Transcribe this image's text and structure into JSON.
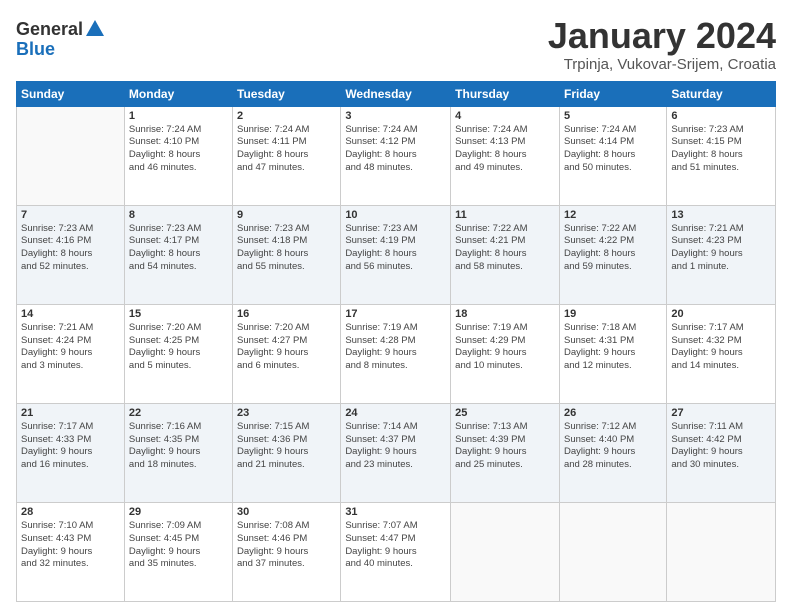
{
  "logo": {
    "general": "General",
    "blue": "Blue"
  },
  "title": {
    "month": "January 2024",
    "location": "Trpinja, Vukovar-Srijem, Croatia"
  },
  "headers": [
    "Sunday",
    "Monday",
    "Tuesday",
    "Wednesday",
    "Thursday",
    "Friday",
    "Saturday"
  ],
  "weeks": [
    [
      {
        "day": "",
        "info": ""
      },
      {
        "day": "1",
        "info": "Sunrise: 7:24 AM\nSunset: 4:10 PM\nDaylight: 8 hours\nand 46 minutes."
      },
      {
        "day": "2",
        "info": "Sunrise: 7:24 AM\nSunset: 4:11 PM\nDaylight: 8 hours\nand 47 minutes."
      },
      {
        "day": "3",
        "info": "Sunrise: 7:24 AM\nSunset: 4:12 PM\nDaylight: 8 hours\nand 48 minutes."
      },
      {
        "day": "4",
        "info": "Sunrise: 7:24 AM\nSunset: 4:13 PM\nDaylight: 8 hours\nand 49 minutes."
      },
      {
        "day": "5",
        "info": "Sunrise: 7:24 AM\nSunset: 4:14 PM\nDaylight: 8 hours\nand 50 minutes."
      },
      {
        "day": "6",
        "info": "Sunrise: 7:23 AM\nSunset: 4:15 PM\nDaylight: 8 hours\nand 51 minutes."
      }
    ],
    [
      {
        "day": "7",
        "info": "Sunrise: 7:23 AM\nSunset: 4:16 PM\nDaylight: 8 hours\nand 52 minutes."
      },
      {
        "day": "8",
        "info": "Sunrise: 7:23 AM\nSunset: 4:17 PM\nDaylight: 8 hours\nand 54 minutes."
      },
      {
        "day": "9",
        "info": "Sunrise: 7:23 AM\nSunset: 4:18 PM\nDaylight: 8 hours\nand 55 minutes."
      },
      {
        "day": "10",
        "info": "Sunrise: 7:23 AM\nSunset: 4:19 PM\nDaylight: 8 hours\nand 56 minutes."
      },
      {
        "day": "11",
        "info": "Sunrise: 7:22 AM\nSunset: 4:21 PM\nDaylight: 8 hours\nand 58 minutes."
      },
      {
        "day": "12",
        "info": "Sunrise: 7:22 AM\nSunset: 4:22 PM\nDaylight: 8 hours\nand 59 minutes."
      },
      {
        "day": "13",
        "info": "Sunrise: 7:21 AM\nSunset: 4:23 PM\nDaylight: 9 hours\nand 1 minute."
      }
    ],
    [
      {
        "day": "14",
        "info": "Sunrise: 7:21 AM\nSunset: 4:24 PM\nDaylight: 9 hours\nand 3 minutes."
      },
      {
        "day": "15",
        "info": "Sunrise: 7:20 AM\nSunset: 4:25 PM\nDaylight: 9 hours\nand 5 minutes."
      },
      {
        "day": "16",
        "info": "Sunrise: 7:20 AM\nSunset: 4:27 PM\nDaylight: 9 hours\nand 6 minutes."
      },
      {
        "day": "17",
        "info": "Sunrise: 7:19 AM\nSunset: 4:28 PM\nDaylight: 9 hours\nand 8 minutes."
      },
      {
        "day": "18",
        "info": "Sunrise: 7:19 AM\nSunset: 4:29 PM\nDaylight: 9 hours\nand 10 minutes."
      },
      {
        "day": "19",
        "info": "Sunrise: 7:18 AM\nSunset: 4:31 PM\nDaylight: 9 hours\nand 12 minutes."
      },
      {
        "day": "20",
        "info": "Sunrise: 7:17 AM\nSunset: 4:32 PM\nDaylight: 9 hours\nand 14 minutes."
      }
    ],
    [
      {
        "day": "21",
        "info": "Sunrise: 7:17 AM\nSunset: 4:33 PM\nDaylight: 9 hours\nand 16 minutes."
      },
      {
        "day": "22",
        "info": "Sunrise: 7:16 AM\nSunset: 4:35 PM\nDaylight: 9 hours\nand 18 minutes."
      },
      {
        "day": "23",
        "info": "Sunrise: 7:15 AM\nSunset: 4:36 PM\nDaylight: 9 hours\nand 21 minutes."
      },
      {
        "day": "24",
        "info": "Sunrise: 7:14 AM\nSunset: 4:37 PM\nDaylight: 9 hours\nand 23 minutes."
      },
      {
        "day": "25",
        "info": "Sunrise: 7:13 AM\nSunset: 4:39 PM\nDaylight: 9 hours\nand 25 minutes."
      },
      {
        "day": "26",
        "info": "Sunrise: 7:12 AM\nSunset: 4:40 PM\nDaylight: 9 hours\nand 28 minutes."
      },
      {
        "day": "27",
        "info": "Sunrise: 7:11 AM\nSunset: 4:42 PM\nDaylight: 9 hours\nand 30 minutes."
      }
    ],
    [
      {
        "day": "28",
        "info": "Sunrise: 7:10 AM\nSunset: 4:43 PM\nDaylight: 9 hours\nand 32 minutes."
      },
      {
        "day": "29",
        "info": "Sunrise: 7:09 AM\nSunset: 4:45 PM\nDaylight: 9 hours\nand 35 minutes."
      },
      {
        "day": "30",
        "info": "Sunrise: 7:08 AM\nSunset: 4:46 PM\nDaylight: 9 hours\nand 37 minutes."
      },
      {
        "day": "31",
        "info": "Sunrise: 7:07 AM\nSunset: 4:47 PM\nDaylight: 9 hours\nand 40 minutes."
      },
      {
        "day": "",
        "info": ""
      },
      {
        "day": "",
        "info": ""
      },
      {
        "day": "",
        "info": ""
      }
    ]
  ]
}
